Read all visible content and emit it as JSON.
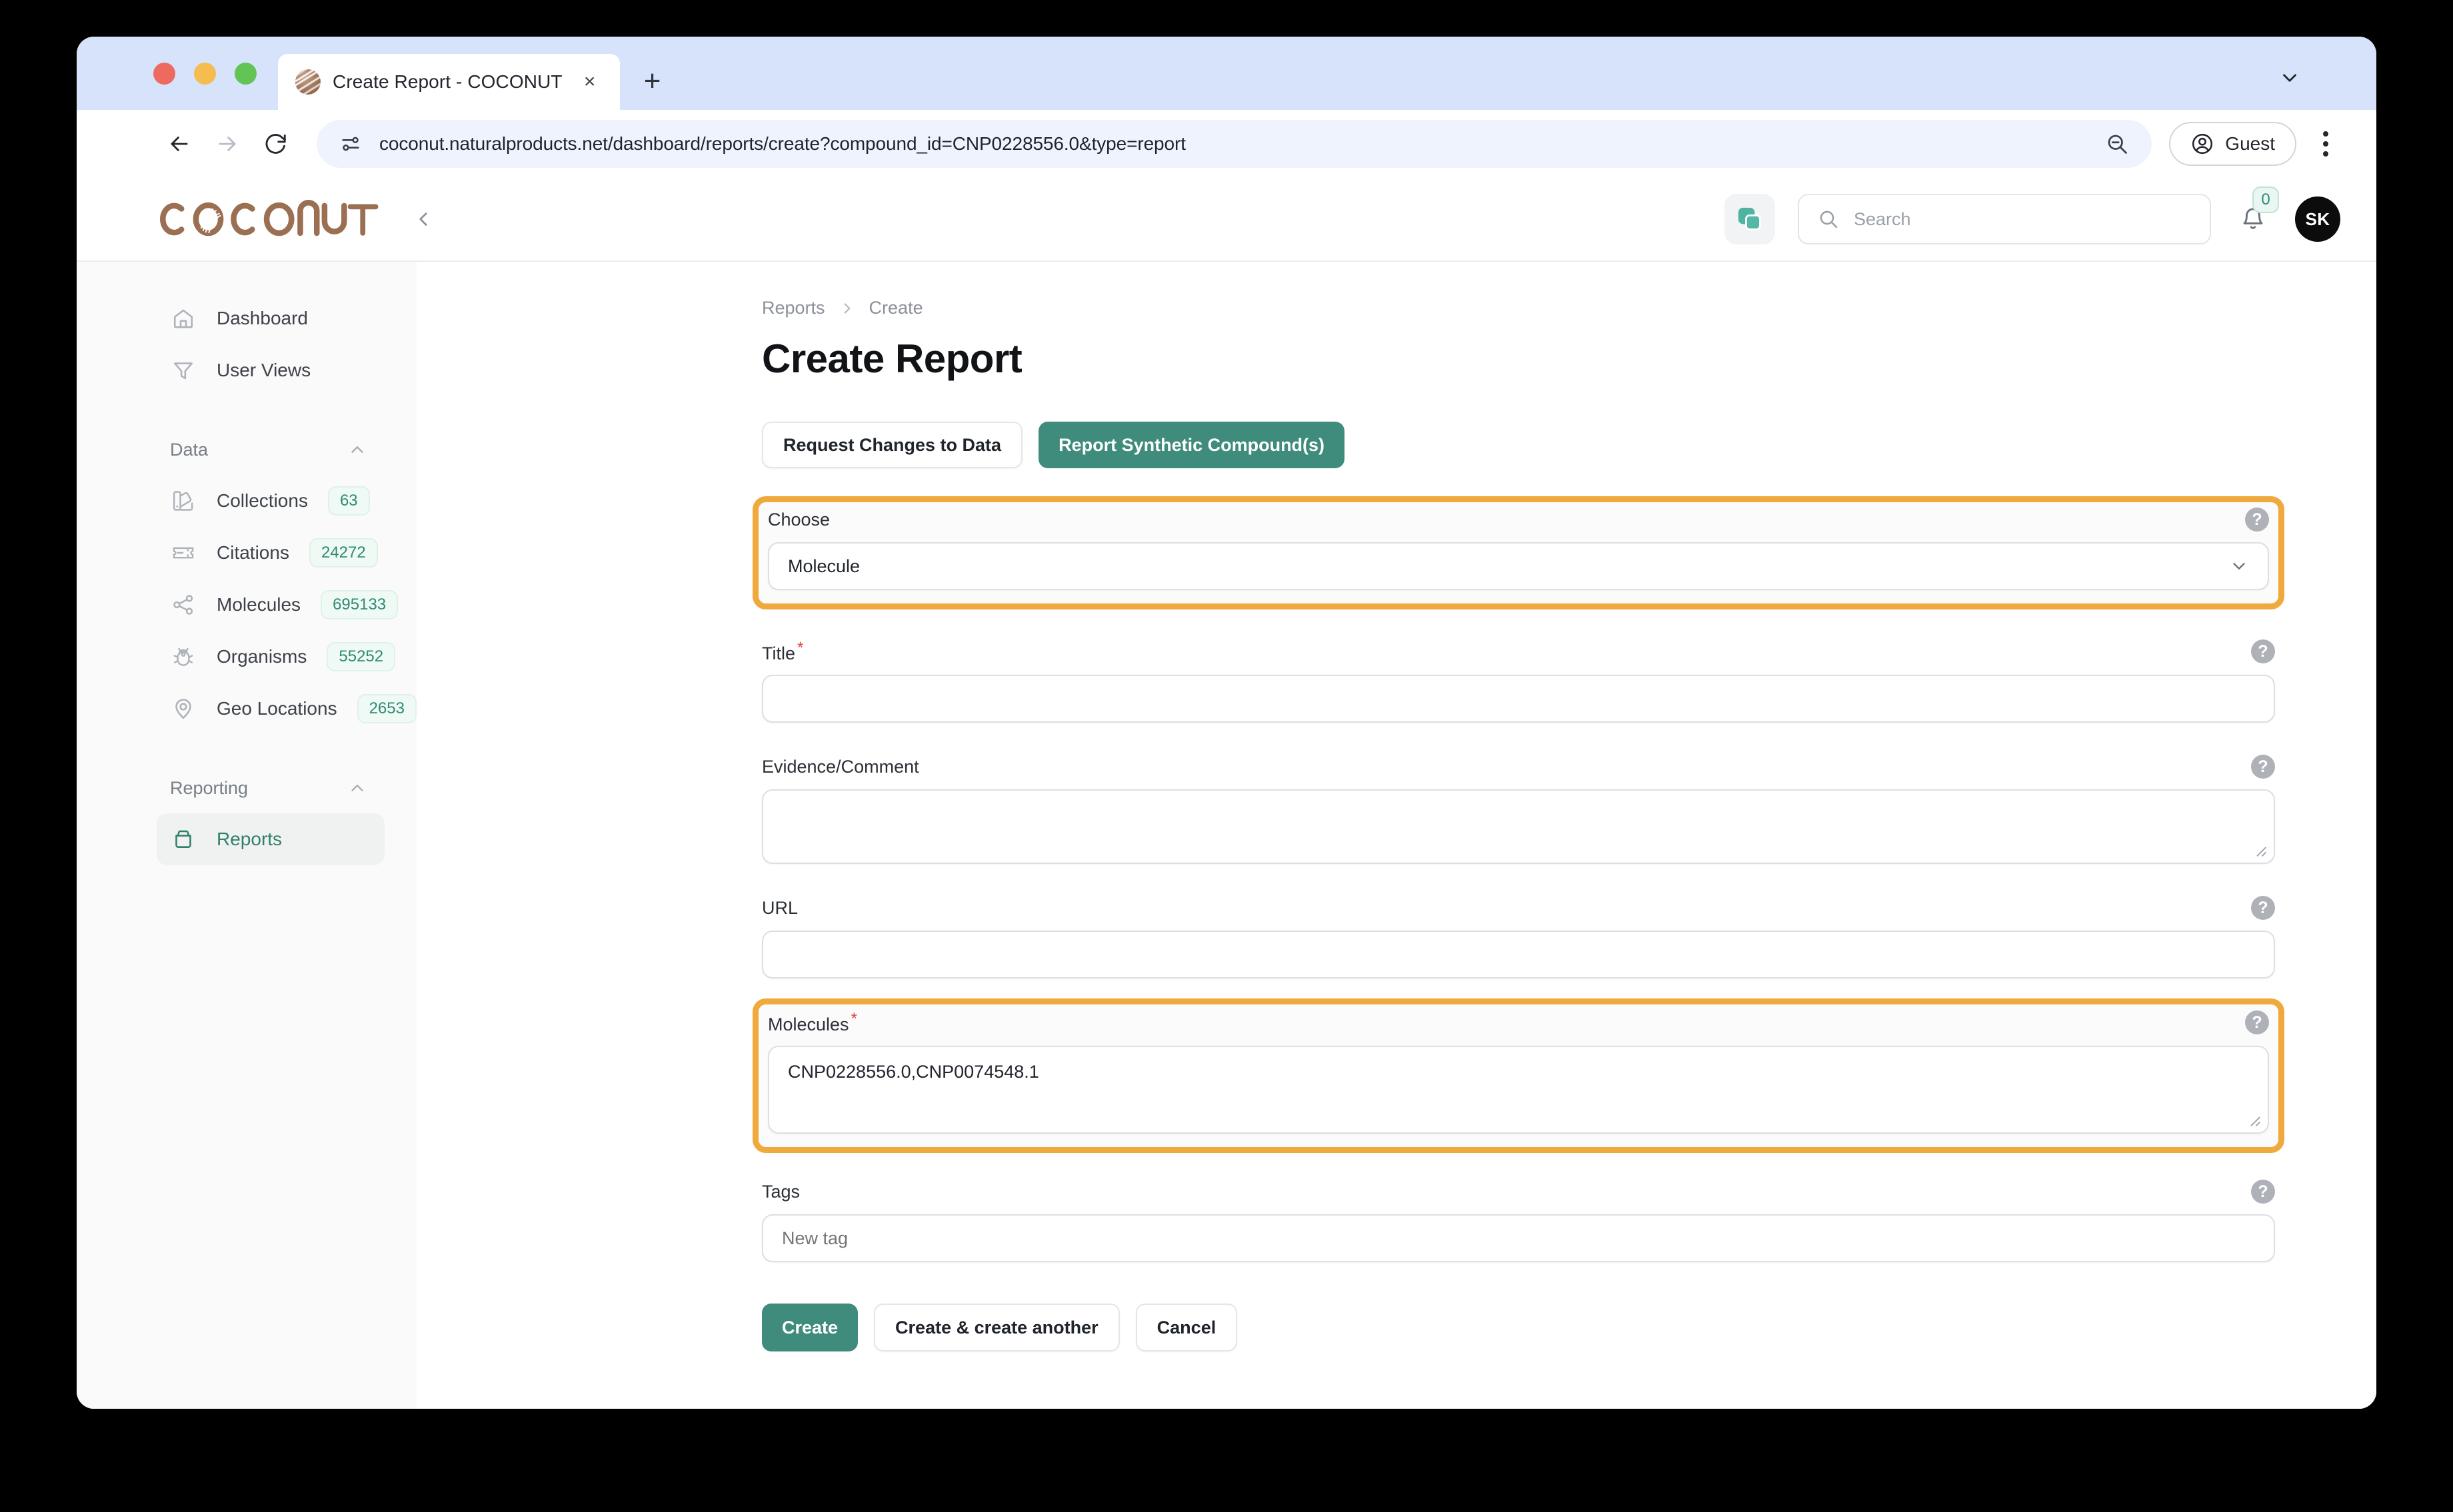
{
  "browser": {
    "tab": {
      "title": "Create Report - COCONUT",
      "close_label": "×",
      "favicon_icon": "coconut-favicon"
    },
    "new_tab_label": "+",
    "url": "coconut.naturalproducts.net/dashboard/reports/create?compound_id=CNP0228556.0&type=report",
    "profile_label": "Guest",
    "icons": {
      "back": "back-arrow-icon",
      "forward": "forward-arrow-icon",
      "reload": "reload-icon",
      "site_info": "site-settings-icon",
      "zoom_out": "zoom-out-icon",
      "profile": "profile-icon",
      "menu": "kebab-menu-icon",
      "tab_list": "tab-list-chevron-icon"
    }
  },
  "app_header": {
    "logo_text": "COCONUT",
    "collapse_icon": "chevron-left-icon",
    "copy_icon": "copy-layers-icon",
    "search": {
      "placeholder": "Search",
      "icon": "search-icon"
    },
    "notifications": {
      "count": "0",
      "icon": "bell-icon"
    },
    "avatar_initials": "SK"
  },
  "sidebar": {
    "top_items": [
      {
        "label": "Dashboard",
        "icon": "home-icon"
      },
      {
        "label": "User Views",
        "icon": "funnel-icon"
      }
    ],
    "sections": [
      {
        "title": "Data",
        "chevron": "chevron-up-icon",
        "items": [
          {
            "label": "Collections",
            "icon": "palette-icon",
            "badge": "63"
          },
          {
            "label": "Citations",
            "icon": "ticket-icon",
            "badge": "24272"
          },
          {
            "label": "Molecules",
            "icon": "share-nodes-icon",
            "badge": "695133"
          },
          {
            "label": "Organisms",
            "icon": "bug-icon",
            "badge": "55252"
          },
          {
            "label": "Geo Locations",
            "icon": "map-pin-icon",
            "badge": "2653"
          }
        ]
      },
      {
        "title": "Reporting",
        "chevron": "chevron-up-icon",
        "items": [
          {
            "label": "Reports",
            "icon": "archive-icon",
            "badge": "",
            "active": true
          }
        ]
      }
    ]
  },
  "main": {
    "breadcrumb": {
      "parent": "Reports",
      "separator": "›",
      "current": "Create"
    },
    "title": "Create Report",
    "tabs": [
      {
        "label": "Request Changes to Data",
        "selected": false
      },
      {
        "label": "Report Synthetic Compound(s)",
        "selected": true
      }
    ],
    "form": {
      "choose": {
        "label": "Choose",
        "value": "Molecule",
        "chevron": "chevron-down-icon",
        "help": "?",
        "highlighted": true
      },
      "title": {
        "label": "Title",
        "required": "*",
        "value": "",
        "help": "?"
      },
      "evidence": {
        "label": "Evidence/Comment",
        "value": "",
        "help": "?"
      },
      "url": {
        "label": "URL",
        "value": "",
        "help": "?"
      },
      "molecules": {
        "label": "Molecules",
        "required": "*",
        "value": "CNP0228556.0,CNP0074548.1",
        "help": "?",
        "highlighted": true
      },
      "tags": {
        "label": "Tags",
        "placeholder": "New tag",
        "value": "",
        "help": "?"
      }
    },
    "actions": [
      {
        "label": "Create",
        "style": "primary"
      },
      {
        "label": "Create & create another",
        "style": "ghost"
      },
      {
        "label": "Cancel",
        "style": "ghost"
      }
    ]
  },
  "colors": {
    "accent_teal": "#3f8c7c",
    "highlight_orange": "#f0a93c",
    "brand_brown": "#9a6f52",
    "required_red": "#e2443d",
    "badge_green": "#2f8a74"
  }
}
